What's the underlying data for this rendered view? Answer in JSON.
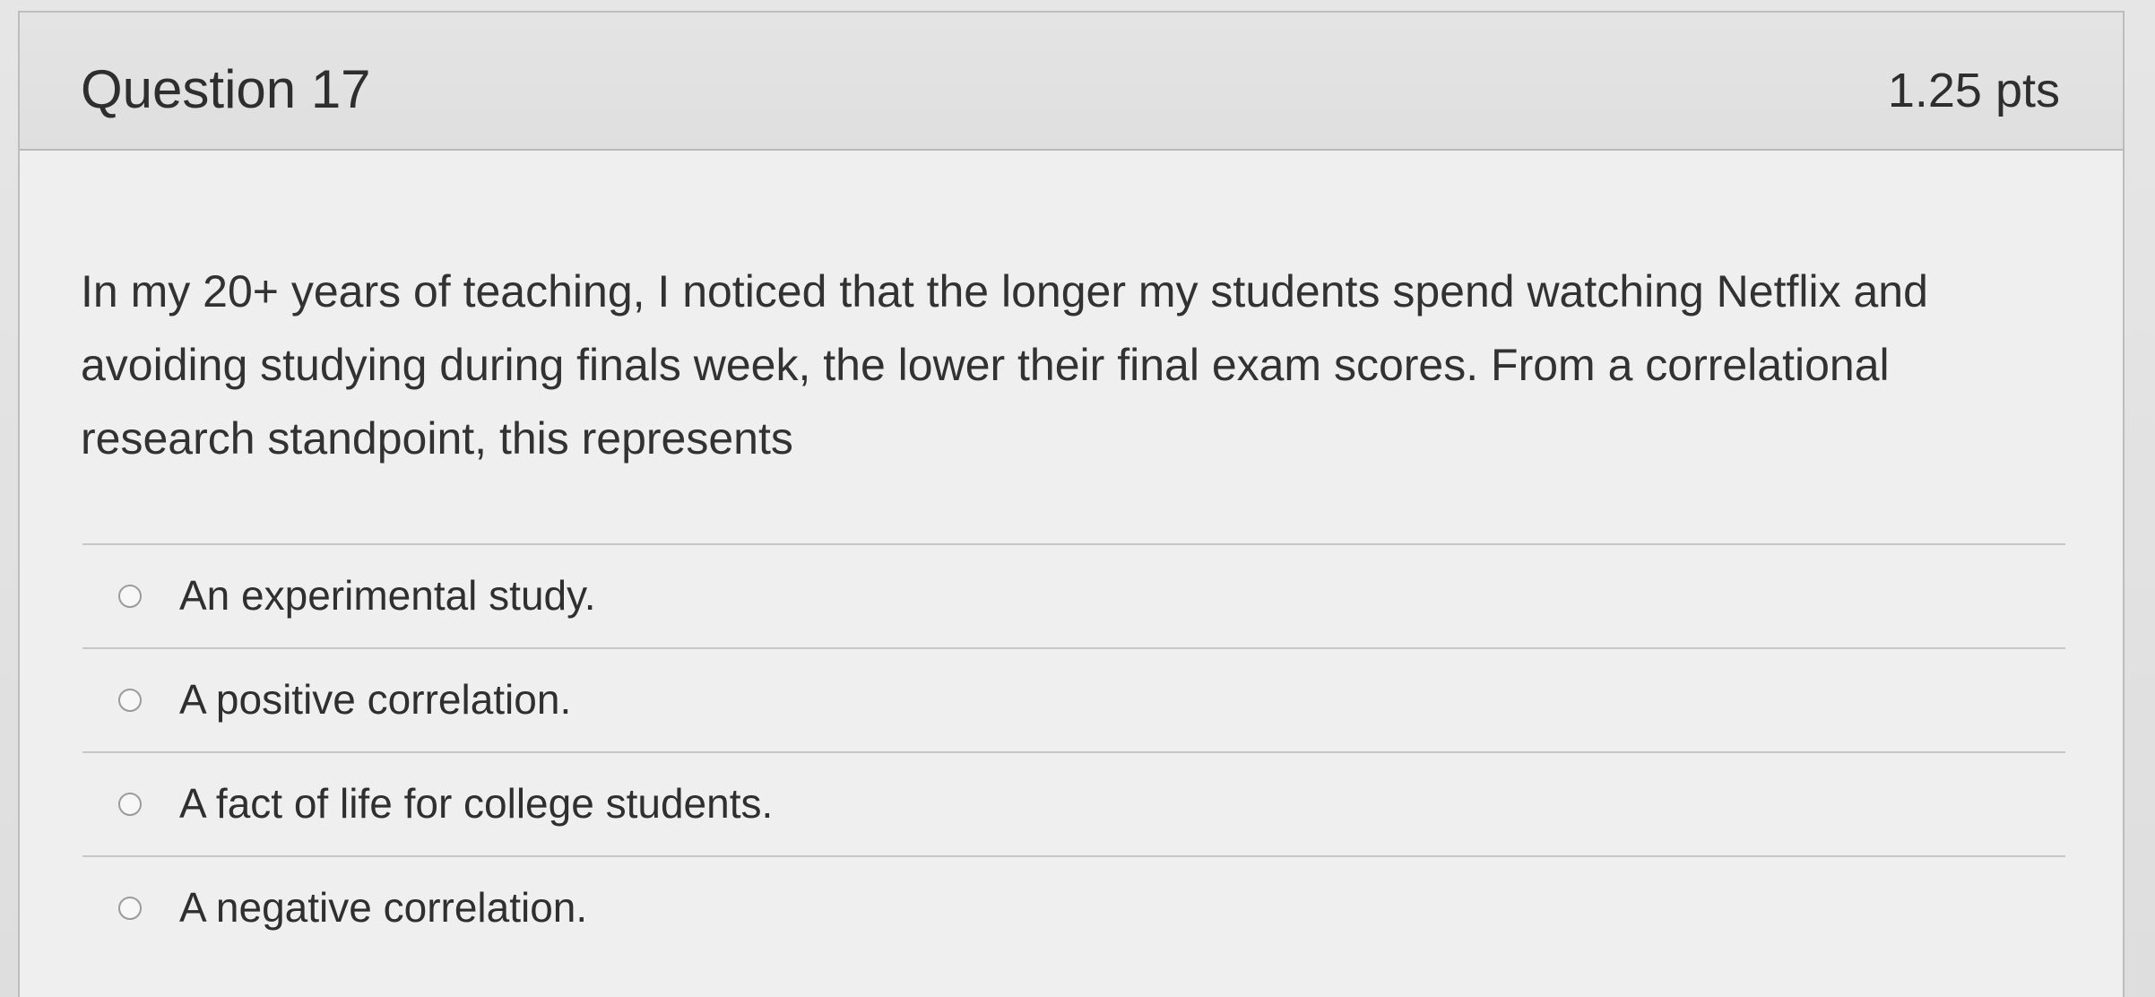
{
  "question": {
    "title": "Question 17",
    "points": "1.25 pts",
    "prompt": "In my 20+ years of teaching, I noticed that the longer my students spend watching Netflix and avoiding studying during finals week, the lower their final exam scores. From a correlational research standpoint, this represents",
    "answers": [
      {
        "label": "An experimental study."
      },
      {
        "label": "A positive correlation."
      },
      {
        "label": "A fact of life for college students."
      },
      {
        "label": "A negative correlation."
      }
    ]
  }
}
